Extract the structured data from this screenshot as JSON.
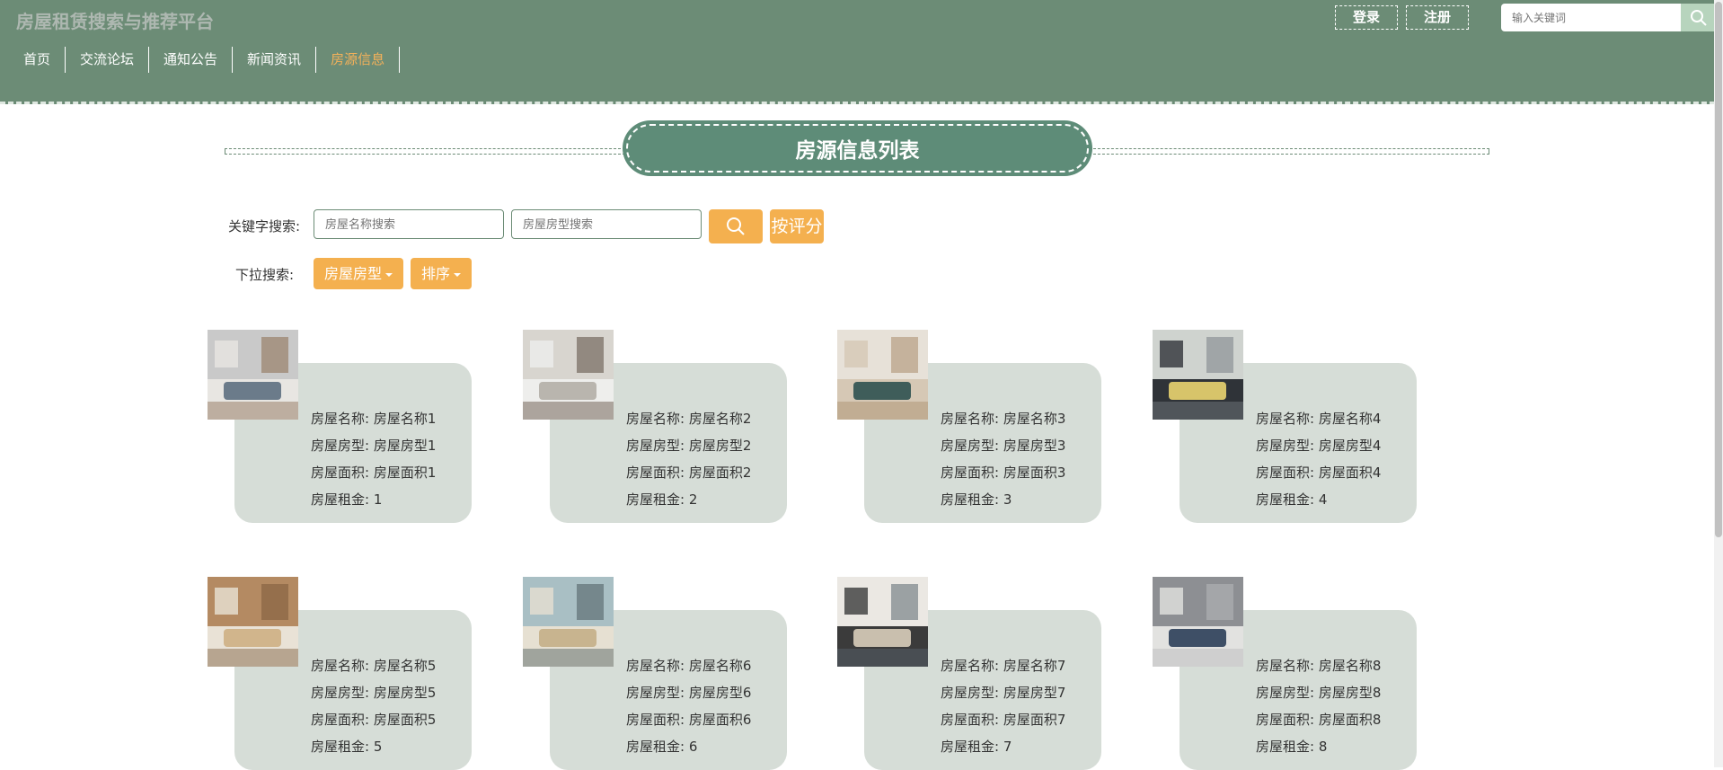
{
  "header": {
    "site_title": "房屋租赁搜索与推荐平台",
    "login_label": "登录",
    "register_label": "注册",
    "search_placeholder": "输入关键词"
  },
  "nav": {
    "items": [
      {
        "label": "首页",
        "active": false
      },
      {
        "label": "交流论坛",
        "active": false
      },
      {
        "label": "通知公告",
        "active": false
      },
      {
        "label": "新闻资讯",
        "active": false
      },
      {
        "label": "房源信息",
        "active": true
      }
    ]
  },
  "main": {
    "section_title": "房源信息列表",
    "keyword_label": "关键字搜索:",
    "name_placeholder": "房屋名称搜索",
    "type_placeholder": "房屋房型搜索",
    "rate_label": "按评分",
    "dropdown_label": "下拉搜索:",
    "type_dropdown": "房屋房型",
    "sort_dropdown": "排序"
  },
  "field_labels": {
    "name": "房屋名称",
    "type": "房屋房型",
    "area": "房屋面积",
    "rent": "房屋租金"
  },
  "listings": [
    {
      "name": "房屋名称1",
      "type": "房屋房型1",
      "area": "房屋面积1",
      "rent": "1"
    },
    {
      "name": "房屋名称2",
      "type": "房屋房型2",
      "area": "房屋面积2",
      "rent": "2"
    },
    {
      "name": "房屋名称3",
      "type": "房屋房型3",
      "area": "房屋面积3",
      "rent": "3"
    },
    {
      "name": "房屋名称4",
      "type": "房屋房型4",
      "area": "房屋面积4",
      "rent": "4"
    },
    {
      "name": "房屋名称5",
      "type": "房屋房型5",
      "area": "房屋面积5",
      "rent": "5"
    },
    {
      "name": "房屋名称6",
      "type": "房屋房型6",
      "area": "房屋面积6",
      "rent": "6"
    },
    {
      "name": "房屋名称7",
      "type": "房屋房型7",
      "area": "房屋面积7",
      "rent": "7"
    },
    {
      "name": "房屋名称8",
      "type": "房屋房型8",
      "area": "房屋面积8",
      "rent": "8"
    }
  ],
  "colors": {
    "header_bg": "#6c8c76",
    "accent_orange": "#f4b04f",
    "active_nav": "#f3b15a",
    "card_bg": "#d6ddd7",
    "title_pill": "#5e8c78"
  }
}
